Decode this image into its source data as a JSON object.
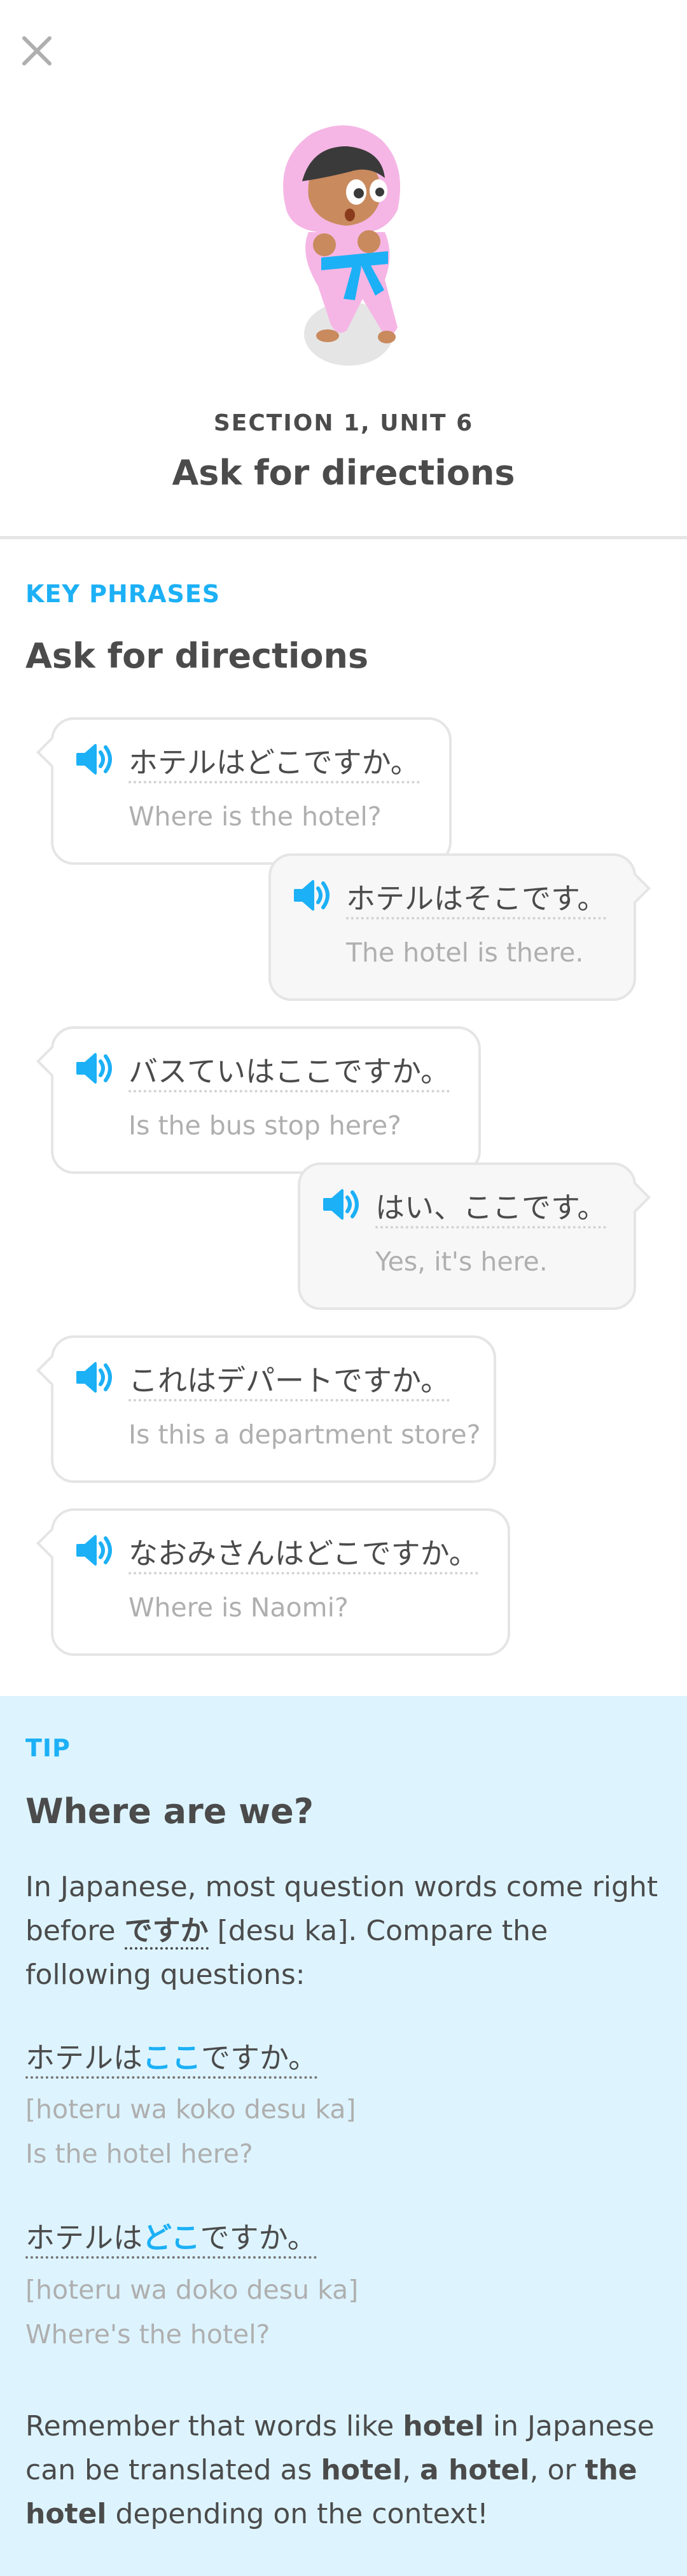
{
  "header": {
    "close_icon": "close-icon",
    "section_label": "SECTION 1, UNIT 6",
    "title": "Ask for directions"
  },
  "key_phrases": {
    "label": "KEY PHRASES",
    "title": "Ask for directions",
    "speaker_icon": "speaker-icon",
    "phrases": [
      {
        "side": "left",
        "jp": "ホテルはどこですか。",
        "en": "Where is the hotel?"
      },
      {
        "side": "right",
        "jp": "ホテルはそこです。",
        "en": "The hotel is there."
      },
      {
        "side": "left",
        "jp": "バスていはここですか。",
        "en": "Is the bus stop here?"
      },
      {
        "side": "right",
        "jp": "はい、ここです。",
        "en": "Yes, it's here."
      },
      {
        "side": "left",
        "jp": "これはデパートですか。",
        "en": "Is this a department store?"
      },
      {
        "side": "left",
        "jp": "なおみさんはどこですか。",
        "en": "Where is Naomi?"
      }
    ]
  },
  "tip": {
    "label": "TIP",
    "title": "Where are we?",
    "intro_1": "In Japanese, most question words come right before ",
    "intro_desuka": "ですか",
    "intro_2": " [desu ka]. Compare the following questions:",
    "examples": [
      {
        "jp_pre": "ホテルは",
        "jp_hl": "ここ",
        "jp_post": "ですか。",
        "romaji": "[hoteru wa koko desu ka]",
        "en": "Is the hotel here?"
      },
      {
        "jp_pre": "ホテルは",
        "jp_hl": "どこ",
        "jp_post": "ですか。",
        "romaji": "[hoteru wa doko desu ka]",
        "en": "Where's the hotel?"
      }
    ],
    "closing_1": "Remember that words like ",
    "closing_hotel": "hotel",
    "closing_2": " in Japanese can be translated as ",
    "closing_b1": "hotel",
    "closing_3": ", ",
    "closing_b2": "a hotel",
    "closing_4": ", or ",
    "closing_b3": "the hotel",
    "closing_5": " depending on the context!"
  },
  "colors": {
    "accent": "#1cb0f6",
    "tip_bg": "#ddf4ff",
    "text": "#4b4b4b",
    "muted": "#afafaf"
  }
}
